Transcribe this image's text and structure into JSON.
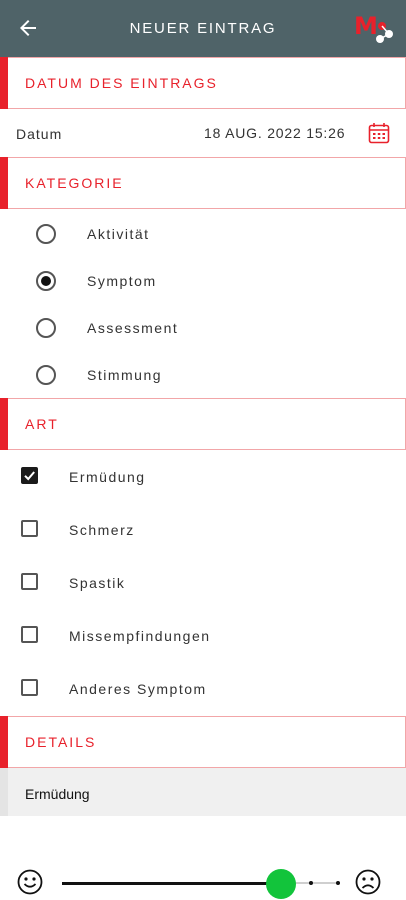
{
  "header": {
    "title": "NEUER EINTRAG",
    "back_icon": "arrow-left-icon",
    "logo_text": "M",
    "logo_icon": "share-nodes-icon",
    "background_color": "#4f6368",
    "accent_color": "#e8212b"
  },
  "sections": {
    "datum": "DATUM DES EINTRAGS",
    "kategorie": "KATEGORIE",
    "art": "ART",
    "details": "DETAILS"
  },
  "date_row": {
    "label": "Datum",
    "value": "18 AUG. 2022 15:26",
    "icon": "calendar-icon"
  },
  "categories": [
    {
      "label": "Aktivität",
      "selected": false
    },
    {
      "label": "Symptom",
      "selected": true
    },
    {
      "label": "Assessment",
      "selected": false
    },
    {
      "label": "Stimmung",
      "selected": false
    }
  ],
  "types": [
    {
      "label": "Ermüdung",
      "checked": true
    },
    {
      "label": "Schmerz",
      "checked": false
    },
    {
      "label": "Spastik",
      "checked": false
    },
    {
      "label": "Missempfindungen",
      "checked": false
    },
    {
      "label": "Anderes Symptom",
      "checked": false
    }
  ],
  "details": {
    "value": "Ermüdung"
  },
  "slider": {
    "left_icon": "smiley-happy-icon",
    "right_icon": "smiley-sad-icon",
    "value_fraction": 0.78,
    "thumb_color": "#12c43b"
  }
}
